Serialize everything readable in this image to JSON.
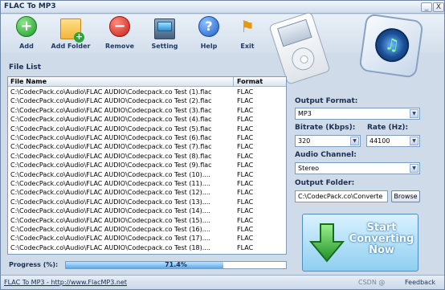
{
  "window": {
    "title": "FLAC To MP3",
    "min_glyph": "_",
    "close_glyph": "X"
  },
  "toolbar": {
    "items": [
      {
        "label": "Add",
        "icon": "add-icon"
      },
      {
        "label": "Add Folder",
        "icon": "add-folder-icon"
      },
      {
        "label": "Remove",
        "icon": "remove-icon"
      },
      {
        "label": "Setting",
        "icon": "setting-icon"
      },
      {
        "label": "Help",
        "icon": "help-icon"
      },
      {
        "label": "Exit",
        "icon": "exit-icon"
      }
    ]
  },
  "file_list": {
    "section_label": "File List",
    "columns": [
      "File Name",
      "Format"
    ],
    "rows": [
      {
        "name": "C:\\CodecPack.co\\Audio\\FLAC AUDIO\\Codecpack.co  Test (1).flac",
        "format": "FLAC"
      },
      {
        "name": "C:\\CodecPack.co\\Audio\\FLAC AUDIO\\Codecpack.co  Test (2).flac",
        "format": "FLAC"
      },
      {
        "name": "C:\\CodecPack.co\\Audio\\FLAC AUDIO\\Codecpack.co  Test (3).flac",
        "format": "FLAC"
      },
      {
        "name": "C:\\CodecPack.co\\Audio\\FLAC AUDIO\\Codecpack.co  Test (4).flac",
        "format": "FLAC"
      },
      {
        "name": "C:\\CodecPack.co\\Audio\\FLAC AUDIO\\Codecpack.co  Test (5).flac",
        "format": "FLAC"
      },
      {
        "name": "C:\\CodecPack.co\\Audio\\FLAC AUDIO\\Codecpack.co  Test (6).flac",
        "format": "FLAC"
      },
      {
        "name": "C:\\CodecPack.co\\Audio\\FLAC AUDIO\\Codecpack.co  Test (7).flac",
        "format": "FLAC"
      },
      {
        "name": "C:\\CodecPack.co\\Audio\\FLAC AUDIO\\Codecpack.co  Test (8).flac",
        "format": "FLAC"
      },
      {
        "name": "C:\\CodecPack.co\\Audio\\FLAC AUDIO\\Codecpack.co  Test (9).flac",
        "format": "FLAC"
      },
      {
        "name": "C:\\CodecPack.co\\Audio\\FLAC AUDIO\\Codecpack.co  Test (10)....",
        "format": "FLAC"
      },
      {
        "name": "C:\\CodecPack.co\\Audio\\FLAC AUDIO\\Codecpack.co  Test (11)....",
        "format": "FLAC"
      },
      {
        "name": "C:\\CodecPack.co\\Audio\\FLAC AUDIO\\Codecpack.co  Test (12)....",
        "format": "FLAC"
      },
      {
        "name": "C:\\CodecPack.co\\Audio\\FLAC AUDIO\\Codecpack.co  Test (13)....",
        "format": "FLAC"
      },
      {
        "name": "C:\\CodecPack.co\\Audio\\FLAC AUDIO\\Codecpack.co  Test (14)....",
        "format": "FLAC"
      },
      {
        "name": "C:\\CodecPack.co\\Audio\\FLAC AUDIO\\Codecpack.co  Test (15)....",
        "format": "FLAC"
      },
      {
        "name": "C:\\CodecPack.co\\Audio\\FLAC AUDIO\\Codecpack.co  Test (16)....",
        "format": "FLAC"
      },
      {
        "name": "C:\\CodecPack.co\\Audio\\FLAC AUDIO\\Codecpack.co  Test (17)....",
        "format": "FLAC"
      },
      {
        "name": "C:\\CodecPack.co\\Audio\\FLAC AUDIO\\Codecpack.co  Test (18)....",
        "format": "FLAC"
      }
    ]
  },
  "progress": {
    "label": "Progress (%):",
    "value_text": "71.4%",
    "fraction": 0.714
  },
  "settings": {
    "output_format_label": "Output Format:",
    "output_format_value": "MP3",
    "bitrate_label": "Bitrate (Kbps):",
    "bitrate_value": "320",
    "rate_label": "Rate (Hz):",
    "rate_value": "44100",
    "channel_label": "Audio Channel:",
    "channel_value": "Stereo",
    "output_folder_label": "Output Folder:",
    "output_folder_value": "C:\\CodecPack.co\\Converte",
    "browse_label": "Browse"
  },
  "convert_button": {
    "line1": "Start",
    "line2": "Converting",
    "line3": "Now"
  },
  "status_bar": {
    "link": "FLAC To MP3 - http://www.FlacMP3.net",
    "watermark": "CSDN @",
    "feedback": "Feedback"
  },
  "colors": {
    "accent": "#4b8fc3",
    "title": "#1b2f52",
    "panel": "#cfdbe9"
  }
}
